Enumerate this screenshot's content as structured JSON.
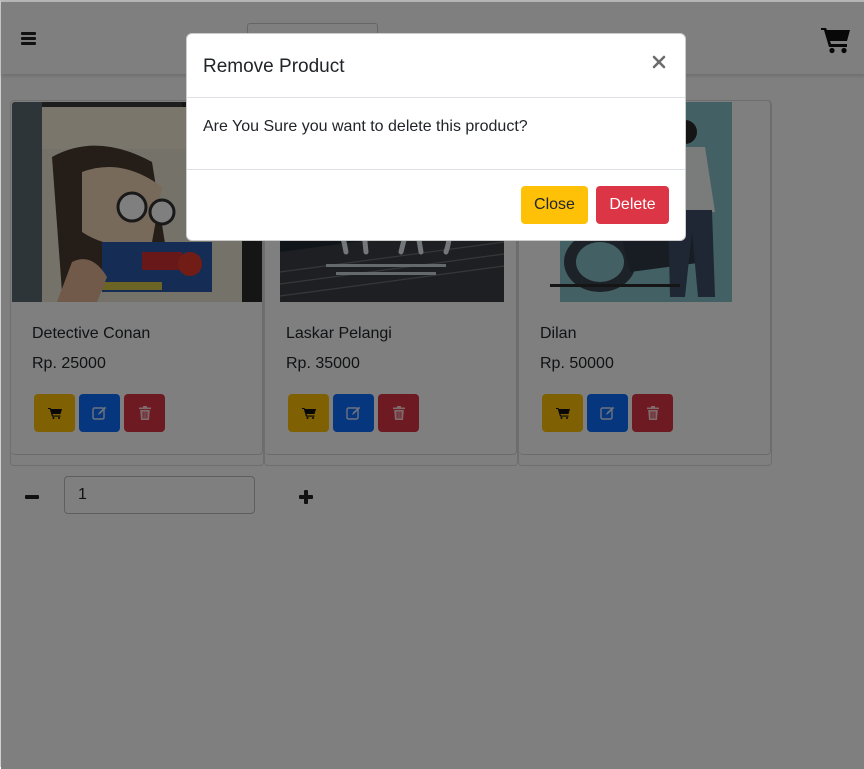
{
  "navbar": {
    "menu_icon": "hamburger-icon",
    "cart_icon": "shopping-cart-icon"
  },
  "products": [
    {
      "title": "Detective Conan",
      "price": "Rp. 25000"
    },
    {
      "title": "Laskar Pelangi",
      "price": "Rp. 35000"
    },
    {
      "title": "Dilan",
      "price": "Rp. 50000"
    }
  ],
  "product_actions": {
    "cart_icon": "cart-icon",
    "edit_icon": "edit-icon",
    "delete_icon": "trash-icon"
  },
  "quantity": {
    "value": "1"
  },
  "modal": {
    "title": "Remove Product",
    "close_symbol": "×",
    "body": "Are You Sure you want to delete this product?",
    "close_label": "Close",
    "delete_label": "Delete"
  },
  "colors": {
    "warning": "#ffc107",
    "primary": "#0d6efd",
    "danger": "#dc3545",
    "backdrop": "rgba(0,0,0,0.5)"
  }
}
